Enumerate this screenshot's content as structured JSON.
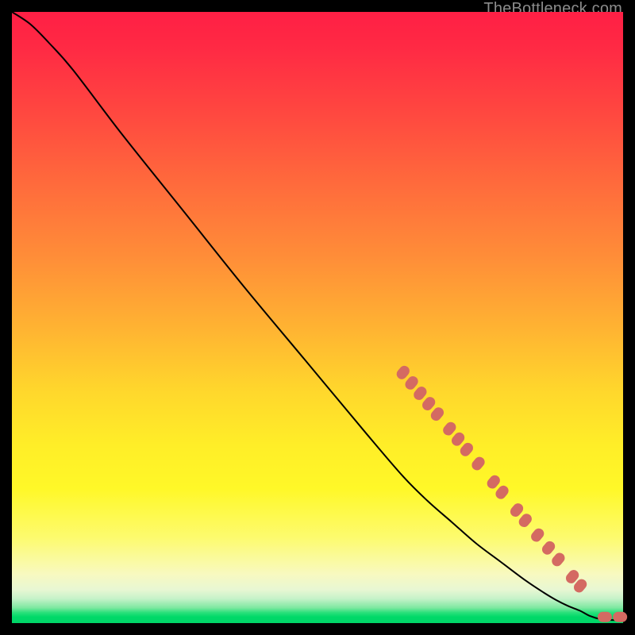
{
  "watermark": "TheBottleneck.com",
  "colors": {
    "background": "#000000",
    "marker": "#d46a62",
    "curve": "#000000",
    "gradient_top": "#ff1f45",
    "gradient_mid": "#ffee28",
    "gradient_bottom": "#00d567"
  },
  "chart_data": {
    "type": "line",
    "title": "",
    "xlabel": "",
    "ylabel": "",
    "xlim": [
      0,
      100
    ],
    "ylim": [
      0,
      100
    ],
    "grid": false,
    "legend": false,
    "series": [
      {
        "name": "curve",
        "comment": "Monotone descending curve from top-left to bottom-right; y read as height-from-bottom in percent of plot area.",
        "x": [
          0,
          3,
          6,
          10,
          18,
          28,
          38,
          48,
          58,
          64,
          68,
          72,
          76,
          80,
          84,
          87,
          89,
          91,
          93,
          94.5,
          96.5,
          98,
          100
        ],
        "y": [
          100,
          98,
          95,
          90.5,
          80,
          67.5,
          55,
          43,
          31,
          24,
          20,
          16.5,
          13,
          10,
          7,
          5,
          3.8,
          2.8,
          2,
          1.2,
          0.6,
          0.5,
          0.5
        ]
      }
    ],
    "markers": {
      "name": "highlighted-points",
      "comment": "Salmon rounded markers along the lower-right portion of the curve plus two near the bottom-right corner.",
      "points": [
        {
          "x": 64.0,
          "y": 41.0
        },
        {
          "x": 65.4,
          "y": 39.3
        },
        {
          "x": 66.8,
          "y": 37.6
        },
        {
          "x": 68.2,
          "y": 35.9
        },
        {
          "x": 69.6,
          "y": 34.2
        },
        {
          "x": 71.6,
          "y": 31.8
        },
        {
          "x": 73.0,
          "y": 30.1
        },
        {
          "x": 74.4,
          "y": 28.4
        },
        {
          "x": 76.3,
          "y": 26.1
        },
        {
          "x": 78.8,
          "y": 23.1
        },
        {
          "x": 80.2,
          "y": 21.4
        },
        {
          "x": 82.6,
          "y": 18.5
        },
        {
          "x": 84.0,
          "y": 16.8
        },
        {
          "x": 86.0,
          "y": 14.4
        },
        {
          "x": 87.8,
          "y": 12.3
        },
        {
          "x": 89.4,
          "y": 10.4
        },
        {
          "x": 91.7,
          "y": 7.6
        },
        {
          "x": 93.0,
          "y": 6.1
        },
        {
          "x": 97.0,
          "y": 1.0
        },
        {
          "x": 99.5,
          "y": 1.0
        }
      ]
    }
  }
}
